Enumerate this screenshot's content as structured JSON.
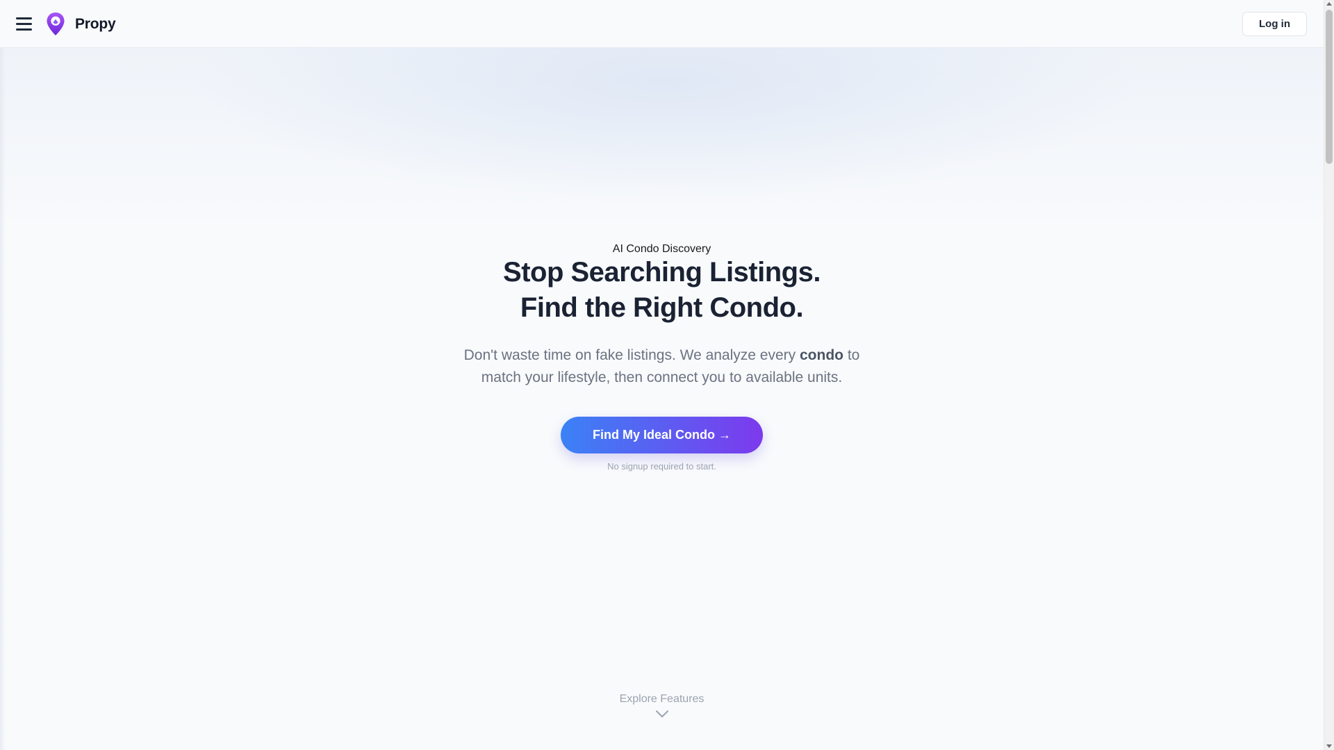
{
  "header": {
    "brand_name": "Propy",
    "menu_icon": "hamburger-menu-icon",
    "logo_icon": "location-pin-logo-icon",
    "login_label": "Log in"
  },
  "hero": {
    "eyebrow": "AI Condo Discovery",
    "headline_line1": "Stop Searching Listings.",
    "headline_line2": "Find the Right Condo.",
    "subtext_part1": "Don't waste time on fake listings. We analyze every ",
    "subtext_emphasis": "condo",
    "subtext_part2": " to match your lifestyle, then connect you to available units.",
    "cta_label": "Find My Ideal Condo →",
    "cta_note": "No signup required to start."
  },
  "footer_prompt": {
    "label": "Explore Features",
    "icon": "chevron-down-icon"
  },
  "colors": {
    "brand_purple": "#7c3aed",
    "gradient_start": "#3b82f6",
    "gradient_end": "#7c3aed",
    "background": "#f8fafc",
    "headline": "#1a2233",
    "muted_text": "#6b7280"
  }
}
